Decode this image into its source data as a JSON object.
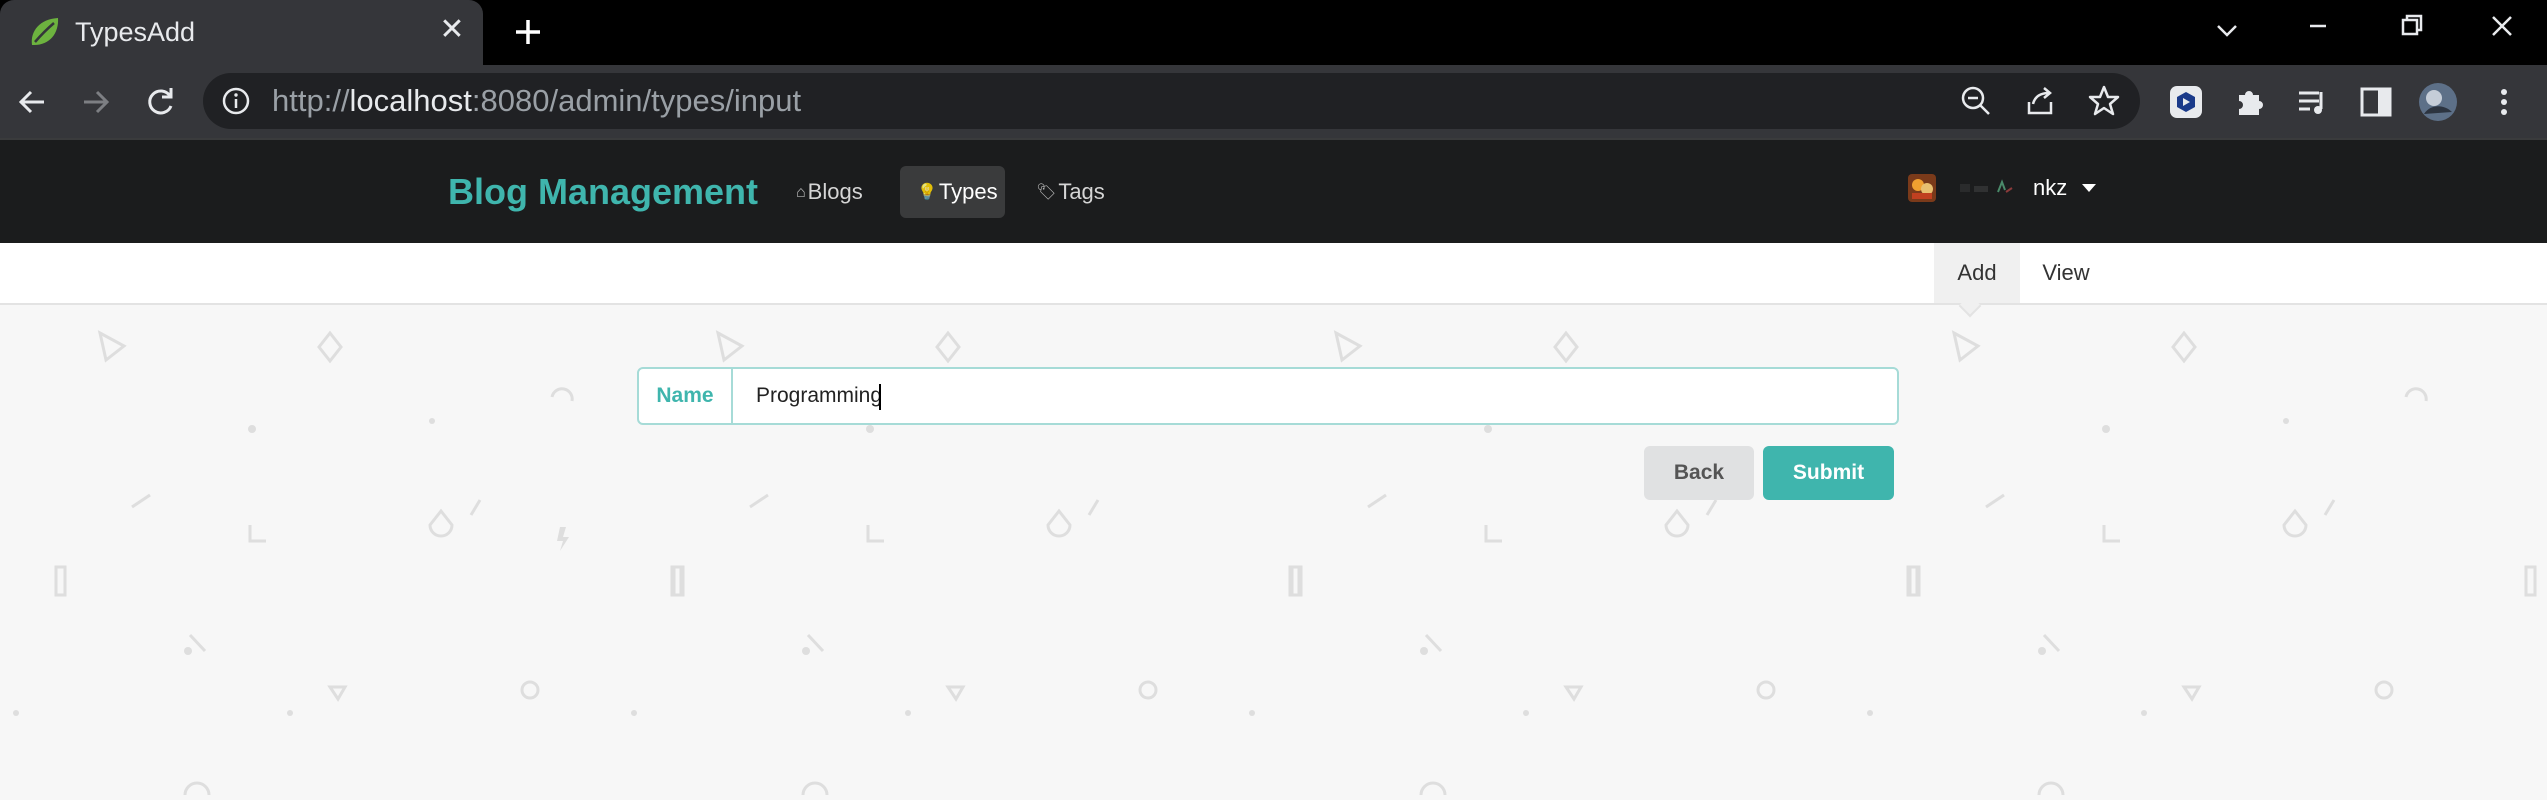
{
  "browser": {
    "tab_title": "TypesAdd",
    "url_scheme": "http://",
    "url_host": "localhost",
    "url_rest": ":8080/admin/types/input"
  },
  "navbar": {
    "brand": "Blog Management",
    "items": [
      {
        "label": "Blogs",
        "icon": "home-icon"
      },
      {
        "label": "Types",
        "icon": "idea-icon"
      },
      {
        "label": "Tags",
        "icon": "tags-icon"
      }
    ],
    "user_name": "nkz"
  },
  "submenu": {
    "add_label": "Add",
    "view_label": "View"
  },
  "form": {
    "name_label": "Name",
    "name_value": "Programming",
    "back_label": "Back",
    "submit_label": "Submit"
  },
  "colors": {
    "accent": "#3fb5ad",
    "navbar_bg": "#1b1c1d",
    "chrome_bg": "#35363a"
  }
}
